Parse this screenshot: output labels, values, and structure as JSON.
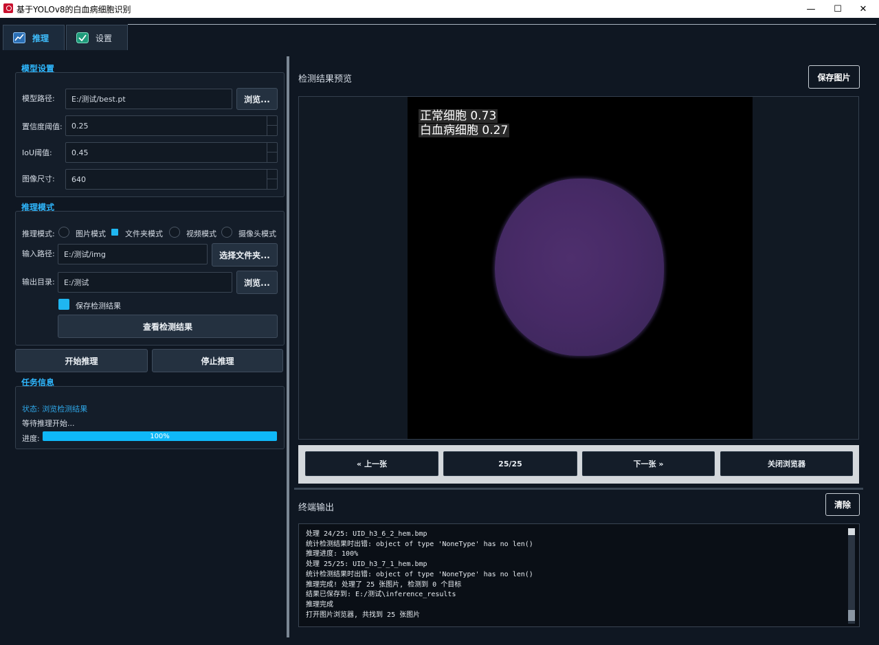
{
  "window": {
    "title": "基于YOLOv8的白血病细胞识别",
    "minimize": "—",
    "maximize": "☐",
    "close": "✕"
  },
  "tabs": [
    {
      "label": "推理",
      "icon": "chart-icon",
      "active": true
    },
    {
      "label": "设置",
      "icon": "check-badge-icon",
      "active": false
    }
  ],
  "model_settings": {
    "section_title": "模型设置",
    "model_path_label": "模型路径:",
    "model_path_value": "E:/测试/best.pt",
    "browse_label": "浏览...",
    "conf_label": "置信度阈值:",
    "conf_value": "0.25",
    "iou_label": "IoU阈值:",
    "iou_value": "0.45",
    "imgsz_label": "图像尺寸:",
    "imgsz_value": "640"
  },
  "inference_mode": {
    "section_title": "推理模式",
    "mode_label": "推理模式:",
    "modes": [
      "图片模式",
      "文件夹模式",
      "视频模式",
      "摄像头模式"
    ],
    "selected_mode": "文件夹模式",
    "input_label": "输入路径:",
    "input_value": "E:/测试/img",
    "select_folder_label": "选择文件夹...",
    "output_label": "输出目录:",
    "output_value": "E:/测试",
    "output_browse_label": "浏览...",
    "save_results_label": "保存检测结果",
    "save_results_checked": true,
    "view_results_label": "查看检测结果"
  },
  "actions": {
    "start_label": "开始推理",
    "stop_label": "停止推理"
  },
  "task_info": {
    "section_title": "任务信息",
    "status": "状态: 浏览检测结果",
    "message": "等待推理开始...",
    "progress_label": "进度:",
    "progress_value": 1.0,
    "progress_text": "100%"
  },
  "preview": {
    "title": "检测结果预览",
    "save_image_label": "保存图片",
    "detections": [
      "正常细胞 0.73",
      "白血病细胞 0.27"
    ]
  },
  "navigator": {
    "prev_label": "« 上一张",
    "counter": "25/25",
    "next_label": "下一张 »",
    "close_label": "关闭浏览器"
  },
  "terminal": {
    "title": "终端输出",
    "clear_label": "清除",
    "lines": [
      "处理 24/25: UID_h3_6_2_hem.bmp",
      "统计检测结果时出错: object of type 'NoneType' has no len()",
      "推理进度: 100%",
      "处理 25/25: UID_h3_7_1_hem.bmp",
      "统计检测结果时出错: object of type 'NoneType' has no len()",
      "推理完成! 处理了 25 张图片, 检测到 0 个目标",
      "结果已保存到: E:/测试\\inference_results",
      "推理完成",
      "打开图片浏览器, 共找到 25 张图片"
    ]
  },
  "colors": {
    "accent": "#2fb8ff",
    "progress": "#0fb8f8",
    "background": "#0f1722"
  }
}
